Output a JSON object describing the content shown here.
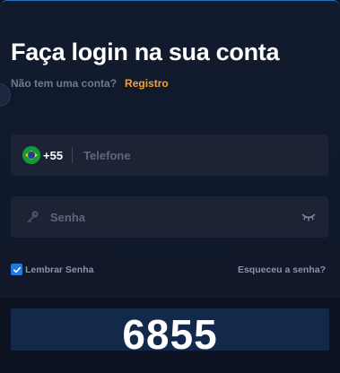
{
  "login": {
    "title": "Faça login na sua conta",
    "no_account_text": "Não tem uma conta?",
    "register_link": "Registro"
  },
  "phone": {
    "country_code": "+55",
    "placeholder": "Telefone",
    "flag_icon": "brazil-flag-icon"
  },
  "password": {
    "placeholder": "Senha",
    "key_icon": "key-icon",
    "visibility_icon": "eye-closed-icon"
  },
  "remember": {
    "label": "Lembrar Senha",
    "checked": true
  },
  "forgot_link": "Esqueceu a senha?",
  "captcha": {
    "code": "6855"
  },
  "colors": {
    "accent_link": "#f4a12a",
    "checkbox": "#1f7ae0",
    "field_bg": "#1b2335"
  }
}
